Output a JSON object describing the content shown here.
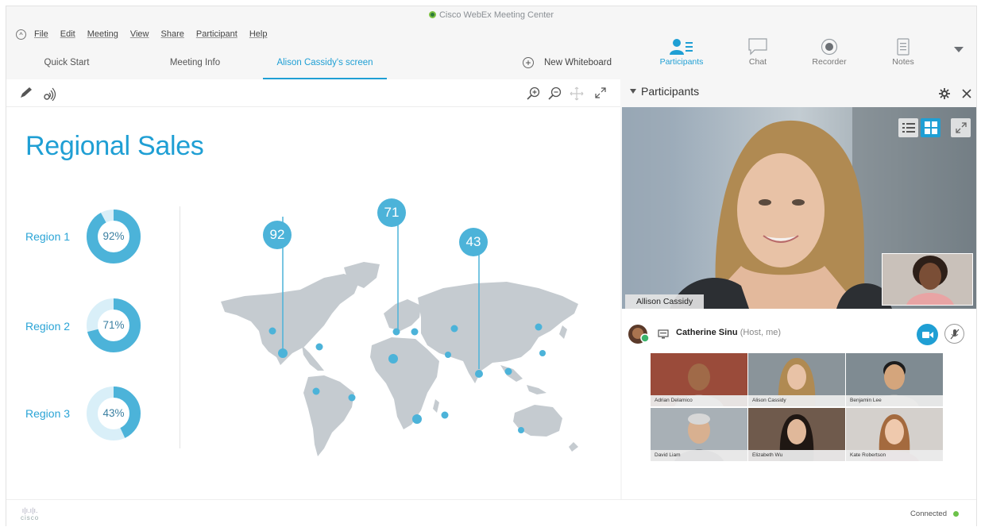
{
  "window": {
    "title": "Cisco WebEx Meeting Center"
  },
  "menu": [
    "File",
    "Edit",
    "Meeting",
    "View",
    "Share",
    "Participant",
    "Help"
  ],
  "tabs": [
    "Quick Start",
    "Meeting Info",
    "Alison Cassidy's screen"
  ],
  "active_tab": "Alison Cassidy's screen",
  "new_whiteboard": "New Whiteboard",
  "right_toolbar": [
    {
      "label": "Participants",
      "icon": "participants-icon",
      "active": true
    },
    {
      "label": "Chat",
      "icon": "chat-icon",
      "active": false
    },
    {
      "label": "Recorder",
      "icon": "recorder-icon",
      "active": false
    },
    {
      "label": "Notes",
      "icon": "notes-icon",
      "active": false
    }
  ],
  "slide": {
    "title": "Regional Sales",
    "regions": [
      {
        "label": "Region 1",
        "value": "92%",
        "fraction": 0.92
      },
      {
        "label": "Region 2",
        "value": "71%",
        "fraction": 0.71
      },
      {
        "label": "Region 3",
        "value": "43%",
        "fraction": 0.43
      }
    ],
    "map_pins": [
      "92",
      "71",
      "43"
    ]
  },
  "participants_panel": {
    "title": "Participants",
    "active_speaker": "Allison Cassidy",
    "me": {
      "name": "Catherine Sinu",
      "role": "(Host, me)"
    },
    "grid": [
      "Adrian Delamico",
      "Alison Cassidy",
      "Benjamin Lee",
      "David Liam",
      "Elizabeth Wu",
      "Kate Robertson"
    ]
  },
  "status": {
    "brand": "cisco",
    "connection": "Connected"
  },
  "colors": {
    "accent": "#1f9fd4",
    "donut_fill": "#4cb3d9",
    "donut_track": "#d9eff8",
    "map": "#c5cbd0",
    "connected": "#6cc24a"
  }
}
